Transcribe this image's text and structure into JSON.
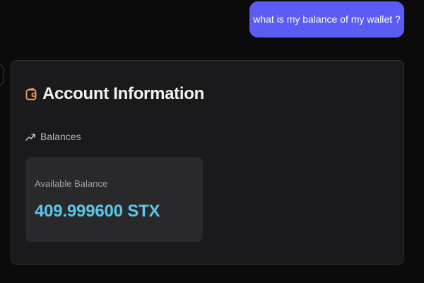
{
  "chat": {
    "user_message": "what is my balance of my wallet ?"
  },
  "account_card": {
    "title": "Account Information",
    "section_label": "Balances",
    "balance": {
      "label": "Available Balance",
      "value": "409.999600 STX"
    }
  },
  "icons": {
    "header": "wallet-icon",
    "section": "trending-up-icon"
  },
  "colors": {
    "background": "#0b0b0c",
    "user_bubble": "#5b5cf6",
    "card_background": "#1a1a1c",
    "balance_box": "#29292c",
    "accent_orange": "#f59e5b",
    "balance_value": "#5ac8e8"
  }
}
